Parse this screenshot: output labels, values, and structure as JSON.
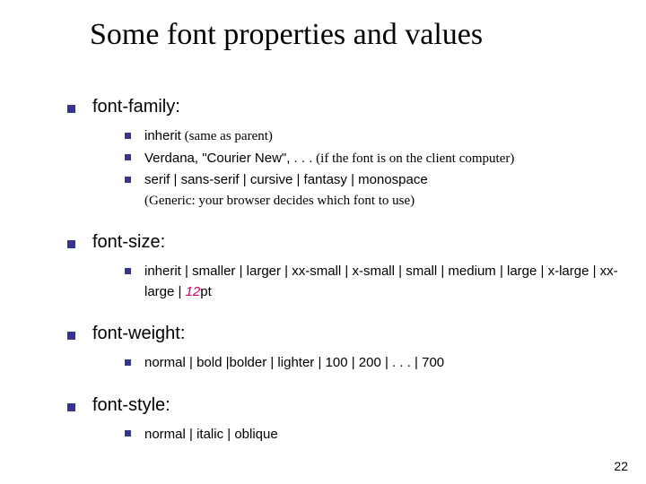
{
  "title": "Some font properties and values",
  "sections": [
    {
      "heading": "font-family:",
      "items": [
        {
          "code": "inherit",
          "note": " (same as parent)"
        },
        {
          "code": "Verdana, \"Courier New\", . . .",
          "note": " (if the font is on the client computer)"
        },
        {
          "code": "serif | sans-serif | cursive | fantasy | monospace",
          "note_below": "(Generic: your browser decides which font to use)"
        }
      ]
    },
    {
      "heading": "font-size:",
      "items": [
        {
          "code_pre": "inherit | smaller | larger | xx-small | x-small | small | medium | large | x-large | xx-large | ",
          "num": "12",
          "code_post": "pt"
        }
      ]
    },
    {
      "heading": "font-weight:",
      "items": [
        {
          "code": "normal | bold |bolder | lighter | 100 | 200 | . . . | 700"
        }
      ]
    },
    {
      "heading": "font-style:",
      "items": [
        {
          "code": "normal | italic | oblique"
        }
      ]
    }
  ],
  "page_number": "22"
}
